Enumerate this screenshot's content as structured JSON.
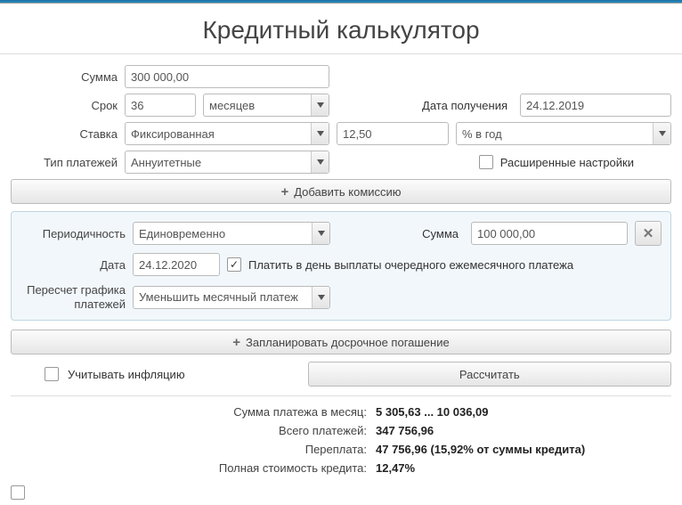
{
  "title": "Кредитный калькулятор",
  "labels": {
    "amount": "Сумма",
    "term": "Срок",
    "dateReceived": "Дата получения",
    "rate": "Ставка",
    "paymentType": "Тип платежей",
    "advanced": "Расширенные настройки",
    "periodicity": "Периодичность",
    "panelAmount": "Сумма",
    "date": "Дата",
    "payOnDay": "Платить в день выплаты очередного ежемесячного платежа",
    "recalc": "Пересчет графика платежей",
    "inflation": "Учитывать инфляцию"
  },
  "inputs": {
    "amount": "300 000,00",
    "term": "36",
    "termUnit": "месяцев",
    "dateReceived": "24.12.2019",
    "rateType": "Фиксированная",
    "rateValue": "12,50",
    "rateUnit": "% в год",
    "paymentType": "Аннуитетные",
    "periodicity": "Единовременно",
    "panelAmount": "100 000,00",
    "panelDate": "24.12.2020",
    "recalcType": "Уменьшить месячный платеж"
  },
  "buttons": {
    "addCommission": "Добавить комиссию",
    "planEarly": "Запланировать досрочное погашение",
    "calculate": "Рассчитать"
  },
  "results": {
    "monthlyLabel": "Сумма платежа в месяц:",
    "monthlyValue": "5 305,63 ... 10 036,09",
    "totalLabel": "Всего платежей:",
    "totalValue": "347 756,96",
    "overpayLabel": "Переплата:",
    "overpayValue": "47 756,96 (15,92% от суммы кредита)",
    "fullCostLabel": "Полная стоимость кредита:",
    "fullCostValue": "12,47%"
  }
}
